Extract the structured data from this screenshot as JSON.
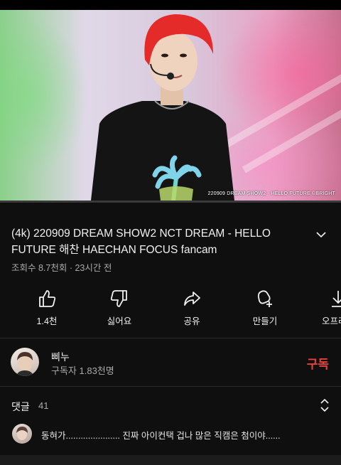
{
  "video": {
    "overlay_caption": "220909 DREAM SHOW2 - HELLO FUTURE ©BRIGHT",
    "progress_fraction": 0.0,
    "accent_color": "#ff0000"
  },
  "title": "(4k) 220909 DREAM SHOW2 NCT DREAM - HELLO FUTURE 해찬 HAECHAN FOCUS fancam",
  "meta": "조회수 8.7천회 · 23시간 전",
  "actions": [
    {
      "label": "1.4천",
      "icon": "thumbs-up-icon"
    },
    {
      "label": "싫어요",
      "icon": "thumbs-down-icon"
    },
    {
      "label": "공유",
      "icon": "share-icon"
    },
    {
      "label": "만들기",
      "icon": "remix-icon"
    },
    {
      "label": "오프라인",
      "icon": "download-icon"
    }
  ],
  "channel": {
    "name": "삐누",
    "subscribers": "구독자 1.83천명",
    "subscribe_label": "구독",
    "subscribe_color": "#e5413d"
  },
  "comments": {
    "title": "댓글",
    "count": "41",
    "top_comment": "동혀가...................... 진짜 아이컨택 겁나 많은 직캠은 첨이야......"
  }
}
